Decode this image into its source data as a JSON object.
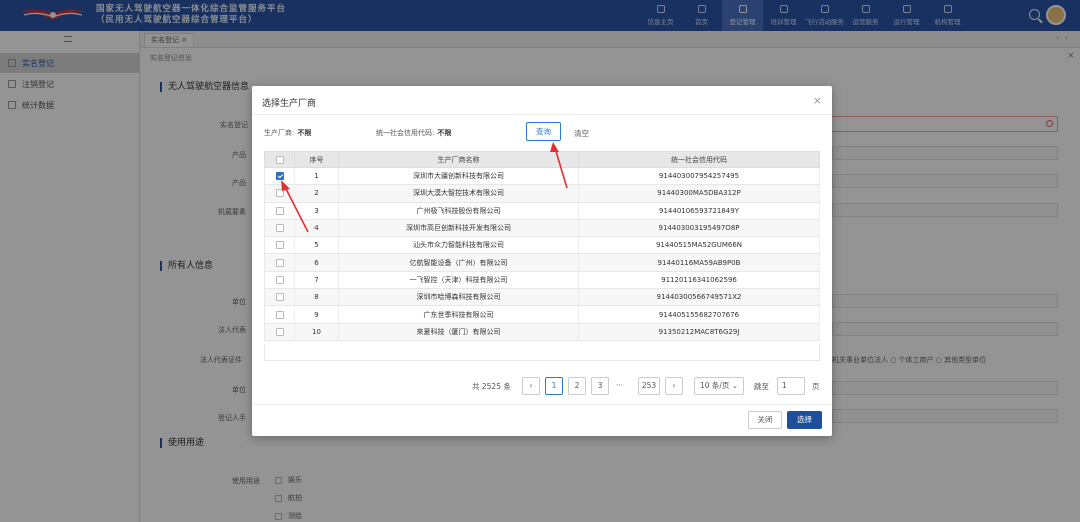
{
  "header": {
    "title_line1": "国家无人驾驶航空器一体化综合监管服务平台",
    "title_line2": "（民用无人驾驶航空器综合管理平台）",
    "nav": [
      {
        "label": "信息主页",
        "active": false
      },
      {
        "label": "首页",
        "active": false
      },
      {
        "label": "登记管理",
        "active": true
      },
      {
        "label": "培训管理",
        "active": false
      },
      {
        "label": "飞行活动服务",
        "active": false
      },
      {
        "label": "运营服务",
        "active": false
      },
      {
        "label": "运行管理",
        "active": false
      },
      {
        "label": "机构管理",
        "active": false
      }
    ]
  },
  "sidebar": {
    "items": [
      {
        "label": "实名登记",
        "active": true
      },
      {
        "label": "注销登记",
        "active": false
      },
      {
        "label": "统计数据",
        "active": false
      }
    ]
  },
  "tabs": [
    {
      "label": "实名登记 ×"
    }
  ],
  "breadcrumb": "实名登记信息",
  "background_form": {
    "section_uav": "无人驾驶航空器信息",
    "section_owner": "所有人信息",
    "section_usage": "使用用途",
    "label_register": "实名登记",
    "label_product": "产品",
    "label_product2": "产品",
    "label_type": "机载要素",
    "label_unit": "单位",
    "label_legal": "法人代表",
    "label_legal_id": "法人代表证件",
    "label_unit2": "单位",
    "label_register2": "登记人手",
    "label_usage": "使用用途",
    "radio_text": "机关事业单位法人 ○ 个体工商户 ○ 其他类型单位",
    "usage_options": [
      "娱乐",
      "航拍",
      "测绘"
    ]
  },
  "modal": {
    "title": "选择生产厂商",
    "filters": {
      "manufacturer_label": "生产厂商:",
      "manufacturer_value": "不限",
      "credit_label": "统一社会信用代码:",
      "credit_value": "不限"
    },
    "query_button": "查询",
    "clear_button": "清空",
    "columns": [
      "序号",
      "生产厂商名称",
      "统一社会信用代码"
    ],
    "rows": [
      {
        "no": "1",
        "name": "深圳市大疆创新科技有限公司",
        "code": "914403007954257495",
        "checked": true
      },
      {
        "no": "2",
        "name": "深圳大漠大智控技术有限公司",
        "code": "91440300MA5DBA312P",
        "checked": false
      },
      {
        "no": "3",
        "name": "广州极飞科技股份有限公司",
        "code": "91440106593721849Y",
        "checked": false
      },
      {
        "no": "4",
        "name": "深圳市高巨创新科技开发有限公司",
        "code": "914403003195497O8P",
        "checked": false
      },
      {
        "no": "5",
        "name": "汕头市众力智能科技有限公司",
        "code": "91440515MA52GUM66N",
        "checked": false
      },
      {
        "no": "6",
        "name": "亿航智能设备（广州）有限公司",
        "code": "91440116MA59AB9P0B",
        "checked": false
      },
      {
        "no": "7",
        "name": "一飞智控（天津）科技有限公司",
        "code": "91120116341062596",
        "checked": false
      },
      {
        "no": "8",
        "name": "深圳市哈博森科技有限公司",
        "code": "91440300566749571X2",
        "checked": false
      },
      {
        "no": "9",
        "name": "广东世季科技有限公司",
        "code": "914405155682707676",
        "checked": false
      },
      {
        "no": "10",
        "name": "來夏科技（厦门）有限公司",
        "code": "91350212MAC8T6G29J",
        "checked": false
      }
    ],
    "pagination": {
      "total": "共 2525 条",
      "prev": "‹",
      "pages": [
        "1",
        "2",
        "3"
      ],
      "ellipsis": "···",
      "last": "253",
      "next": "›",
      "page_size": "10 条/页",
      "goto_label": "跳至",
      "goto_value": "1",
      "goto_suffix": "页"
    },
    "close_button": "关闭",
    "select_button": "选择"
  },
  "colors": {
    "header_bg": "#2b55a6",
    "primary": "#2b7bd6",
    "select_button": "#1d4f9b",
    "annotation": "#e03030"
  }
}
